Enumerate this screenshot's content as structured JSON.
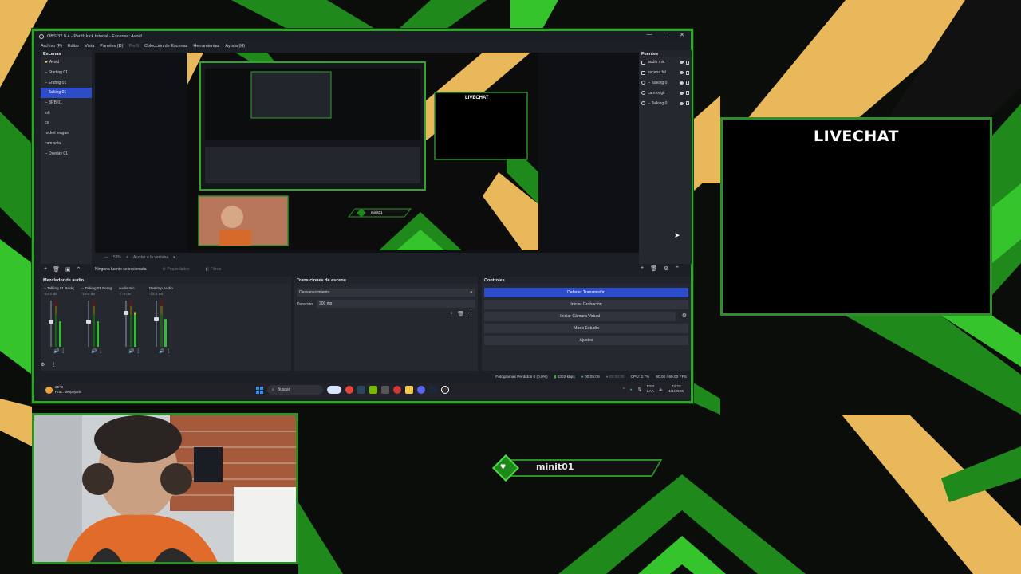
{
  "window": {
    "title": "OBS 32.0.4 - Perfil: kick tutorial - Escenas: Avoid",
    "controls": [
      "—",
      "▢",
      "✕"
    ]
  },
  "menu": [
    "Archivo (F)",
    "Editar",
    "Vista",
    "Paneles (D)",
    "Perfil",
    "Colección de Escenas",
    "Herramientas",
    "Ayuda (H)"
  ],
  "scenes": {
    "title": "Escenas",
    "items": [
      "Avoid",
      "-- Starting 01",
      "-- Ending 01",
      "-- Talking 01",
      "-- BRB 01",
      "lol)",
      "cs",
      "rocket league",
      "cam sola",
      "-- Overlay 01"
    ],
    "active_index": 3
  },
  "sources": {
    "title": "Fuentes",
    "items": [
      "audio mic",
      "escena ful",
      "-- Talking 0",
      "cam origir",
      "-- Talking 0"
    ]
  },
  "preview": {
    "zoom": "53%",
    "fit_label": "Ajustar a la ventana",
    "no_source": "Ninguna fuente seleccionada",
    "properties": "Propiedades",
    "filters": "Filtros",
    "inner_livechat": "LIVECHAT",
    "inner_name": "minit01"
  },
  "mixer": {
    "title": "Mezclador de audio",
    "channels": [
      {
        "name": "-- Talking 01 Backg",
        "db": "-19.0 dB",
        "level": 0.55
      },
      {
        "name": "-- Talking 01 Foreg",
        "db": "-19.0 dB",
        "level": 0.55
      },
      {
        "name": "audio mic",
        "db": "-7.9 dB",
        "level": 0.75
      },
      {
        "name": "Desktop Audio",
        "db": "-15.6 dB",
        "level": 0.6
      }
    ]
  },
  "transitions": {
    "title": "Transiciones de escena",
    "selected": "Desvanecimiento",
    "duration_label": "Duración",
    "duration_value": "300 ms"
  },
  "controls": {
    "title": "Controles",
    "buttons": [
      "Detener Transmisión",
      "Iniciar Grabación",
      "Iniciar Cámara Virtual",
      "Modo Estudio",
      "Ajustes"
    ]
  },
  "status": {
    "dropped": "Fotogramas Perdidos 0 (0.0%)",
    "kbps": "6302 kbps",
    "stream_time": "00:05:09",
    "rec_time": "00:00:00",
    "cpu": "CPU: 2.7%",
    "fps": "60.00 / 60.00 FPS"
  },
  "taskbar": {
    "temp": "25°C",
    "weather": "Prac. despejado",
    "search": "Buscar",
    "lang1": "ESP",
    "lang2": "LAA",
    "time": "23:22",
    "date": "1/1/2026"
  },
  "overlay": {
    "livechat_title": "LIVECHAT",
    "username": "minit01"
  },
  "colors": {
    "accent_green": "#2c8f27",
    "gold": "#e8b65a",
    "obs_blue": "#2d4cc9"
  }
}
